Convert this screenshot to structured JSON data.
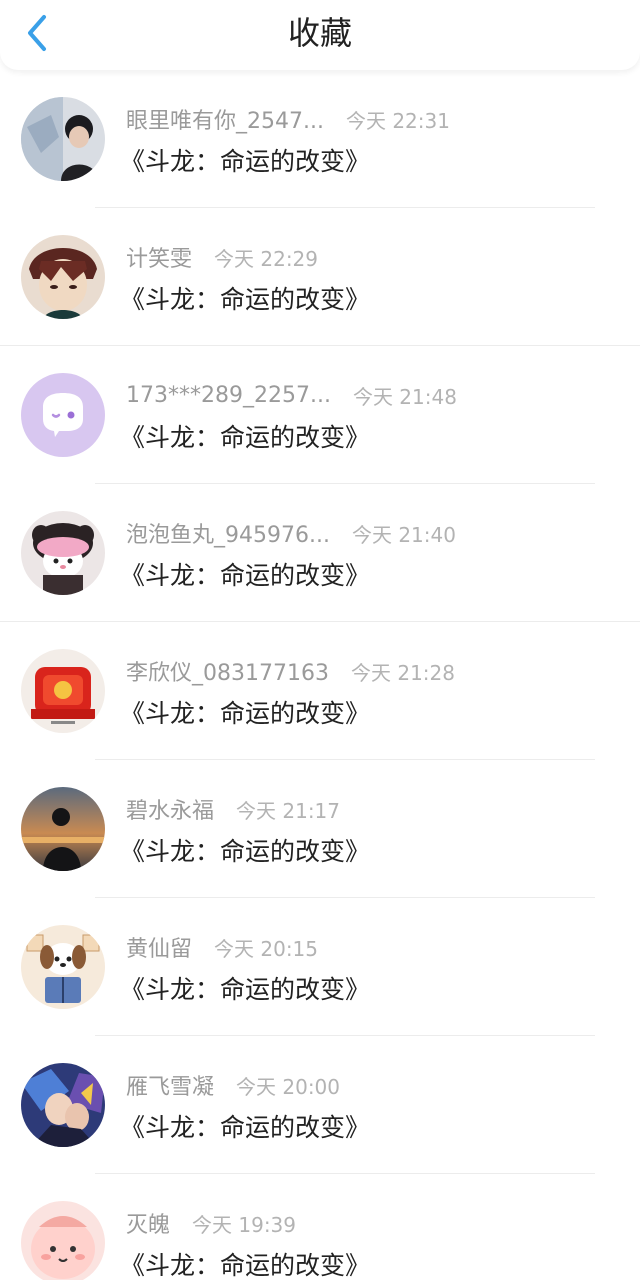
{
  "header": {
    "title": "收藏",
    "back_icon": "chevron-left-icon"
  },
  "colors": {
    "accent": "#3aa0e8",
    "name_text": "#9a9a9a",
    "time_text": "#b3b3b3",
    "title_text": "#222222"
  },
  "favorites": [
    {
      "name": "眼里唯有你_2547...",
      "time": "今天 22:31",
      "work": "《斗龙：命运的改变》"
    },
    {
      "name": "计笑雯",
      "time": "今天 22:29",
      "work": "《斗龙：命运的改变》"
    },
    {
      "name": "173***289_2257...",
      "time": "今天 21:48",
      "work": "《斗龙：命运的改变》"
    },
    {
      "name": "泡泡鱼丸_945976...",
      "time": "今天 21:40",
      "work": "《斗龙：命运的改变》"
    },
    {
      "name": "李欣仪_083177163",
      "time": "今天 21:28",
      "work": "《斗龙：命运的改变》"
    },
    {
      "name": "碧水永福",
      "time": "今天 21:17",
      "work": "《斗龙：命运的改变》"
    },
    {
      "name": "黄仙留",
      "time": "今天 20:15",
      "work": "《斗龙：命运的改变》"
    },
    {
      "name": "雁飞雪凝",
      "time": "今天 20:00",
      "work": "《斗龙：命运的改变》"
    },
    {
      "name": "灭魄",
      "time": "今天 19:39",
      "work": "《斗龙：命运的改变》"
    }
  ]
}
